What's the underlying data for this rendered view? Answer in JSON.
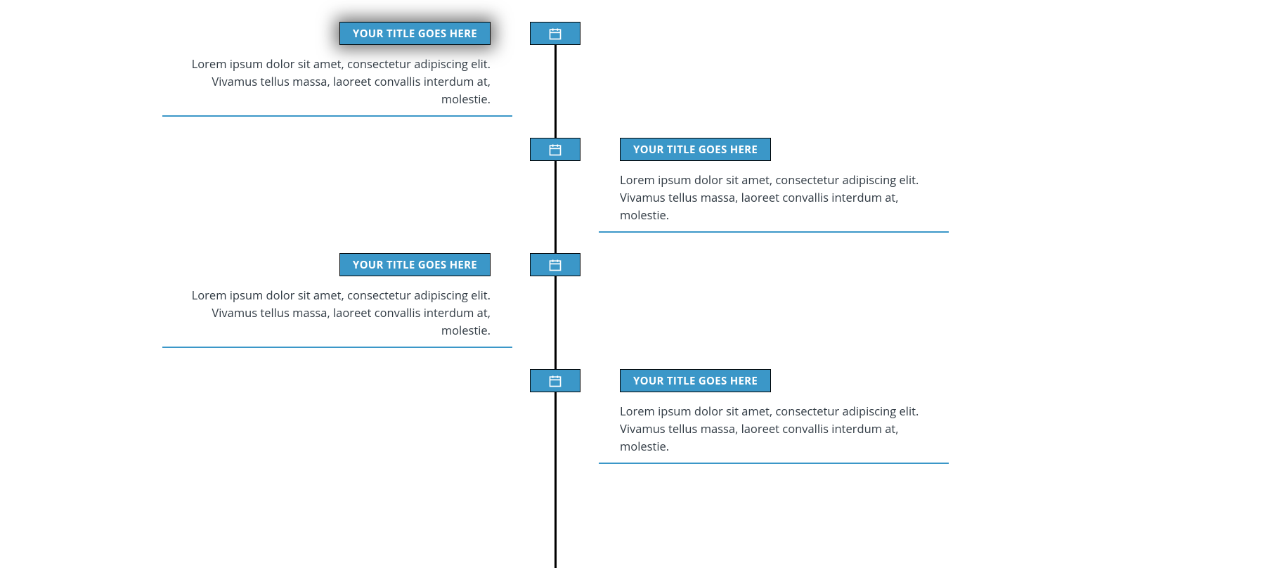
{
  "colors": {
    "accent": "#3b97c8",
    "line": "#000000",
    "text": "#313b44"
  },
  "items": [
    {
      "title": "YOUR TITLE GOES HERE",
      "line1": "Lorem ipsum dolor sit amet, consectetur adipiscing elit.",
      "line2": "Vivamus tellus massa, laoreet convallis interdum at, molestie."
    },
    {
      "title": "YOUR TITLE GOES HERE",
      "line1": "Lorem ipsum dolor sit amet, consectetur adipiscing elit.",
      "line2": "Vivamus tellus massa, laoreet convallis interdum at, molestie."
    },
    {
      "title": "YOUR TITLE GOES HERE",
      "line1": "Lorem ipsum dolor sit amet, consectetur adipiscing elit.",
      "line2": "Vivamus tellus massa, laoreet convallis interdum at, molestie."
    },
    {
      "title": "YOUR TITLE GOES HERE",
      "line1": "Lorem ipsum dolor sit amet, consectetur adipiscing elit.",
      "line2": "Vivamus tellus massa, laoreet convallis interdum at, molestie."
    }
  ]
}
